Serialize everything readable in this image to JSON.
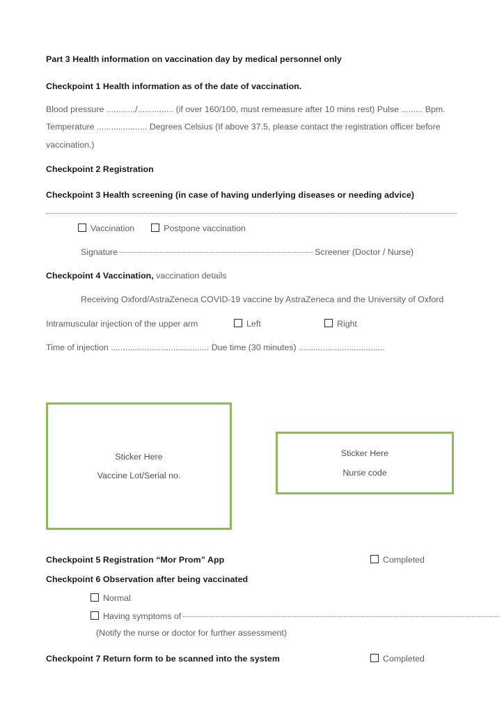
{
  "document": {
    "part_title": "Part 3 Health information on vaccination day by medical personnel only"
  },
  "checkpoint1": {
    "heading": "Checkpoint 1 Health information as of the date of vaccination.",
    "line1": "Blood pressure ............/............... (if over 160/100, must remeasure after 10 mins rest) Pulse ......... Bpm.",
    "line2": "Temperature ..................... Degrees Celsius (If above 37.5, please contact the registration officer before",
    "line3": "vaccination.)"
  },
  "checkpoint2": {
    "heading": "Checkpoint 2 Registration"
  },
  "checkpoint3": {
    "heading": "Checkpoint 3 Health screening (in case of having underlying diseases or needing advice)",
    "options": [
      {
        "label": "Vaccination",
        "checked": false
      },
      {
        "label": "Postpone vaccination",
        "checked": false
      }
    ],
    "signature_label": "Signature",
    "signature_role": "Screener (Doctor / Nurse)"
  },
  "checkpoint4": {
    "heading_bold": "Checkpoint 4 Vaccination,",
    "heading_regular": " vaccination details",
    "vaccine_line": "Receiving Oxford/AstraZeneca COVID-19 vaccine by AstraZeneca and the University of Oxford",
    "injection_label": "Intramuscular injection of the upper arm",
    "arm_options": [
      {
        "label": "Left",
        "checked": false
      },
      {
        "label": "Right",
        "checked": false
      }
    ],
    "time_line": "Time of injection ......................................... Due time (30 minutes) ...................................."
  },
  "stickers": [
    {
      "id": "vaccine-lot",
      "line1": "Sticker Here",
      "line2": "Vaccine Lot/Serial no."
    },
    {
      "id": "nurse-code",
      "line1": "Sticker Here",
      "line2": "Nurse code"
    }
  ],
  "checkpoint5": {
    "heading": "Checkpoint 5 Registration “Mor Prom” App",
    "completed_label": "Completed",
    "completed_checked": false
  },
  "checkpoint6": {
    "heading": "Checkpoint 6 Observation after being vaccinated",
    "option_normal": "Normal",
    "option_symptoms": "Having symptoms of",
    "note": "(Notify the nurse or doctor for further assessment)"
  },
  "checkpoint7": {
    "heading": "Checkpoint 7 Return form to be scanned into the system",
    "completed_label": "Completed",
    "completed_checked": false
  },
  "colors": {
    "sticker_border": "#8fba5c",
    "heading_text": "#1a1a1a",
    "body_text": "#5e5e5e",
    "page_background": "#ffffff"
  }
}
